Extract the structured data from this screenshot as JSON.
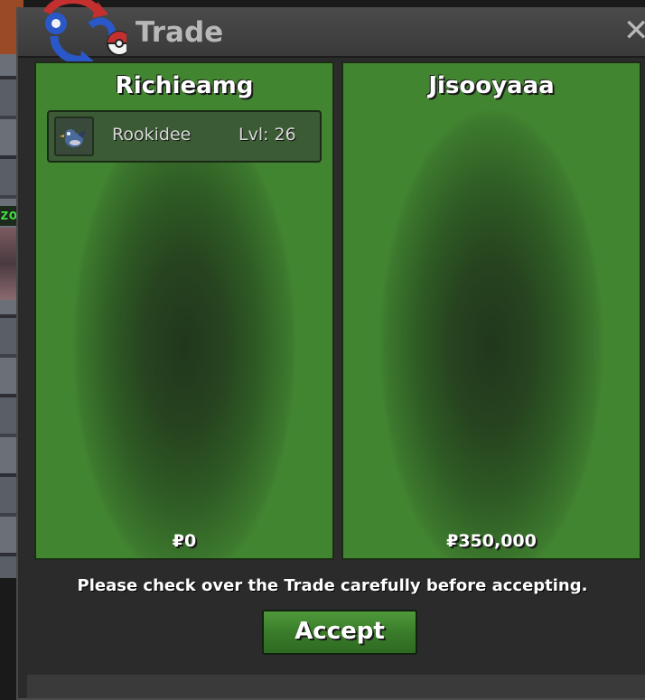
{
  "window": {
    "title": "Trade",
    "close_label": "✕"
  },
  "trade": {
    "left": {
      "player_name": "Richieamg",
      "items": [
        {
          "name": "Rookidee",
          "level": "Lvl: 26"
        }
      ],
      "money": "₽0"
    },
    "right": {
      "player_name": "Jisooyaaa",
      "items": [],
      "money": "₽350,000"
    }
  },
  "notice": "Please check over the Trade carefully before accepting.",
  "buttons": {
    "accept_label": "Accept"
  },
  "colors": {
    "panel_green": "#3d7a2e",
    "panel_center": "#21371c",
    "button_green": "#3a7c2a",
    "window_bg": "#2b2b2b"
  },
  "icons": [
    "trade-logo-icon",
    "close-icon",
    "rookidee-icon"
  ]
}
